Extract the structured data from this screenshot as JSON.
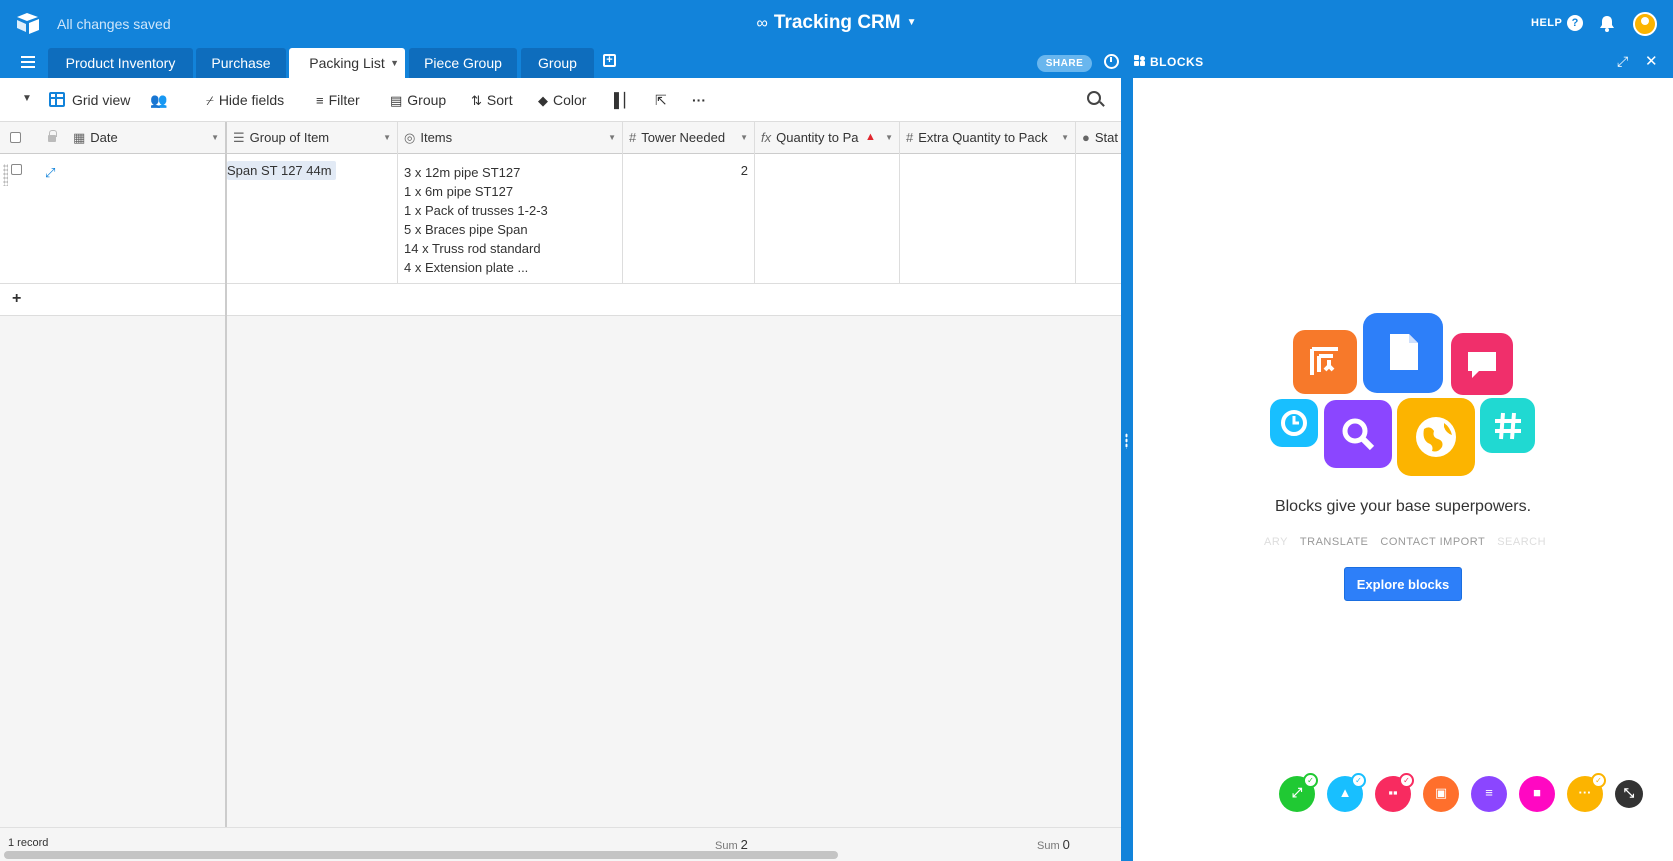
{
  "app": {
    "status_text": "All changes saved",
    "base_title": "Tracking CRM",
    "help_label": "HELP",
    "help_icon_text": "?"
  },
  "tabs": [
    {
      "label": "Product Inventory"
    },
    {
      "label": "Purchase"
    },
    {
      "label": "Packing List",
      "active": true
    },
    {
      "label": "Piece Group"
    },
    {
      "label": "Group"
    }
  ],
  "tabbar": {
    "share_label": "SHARE",
    "blocks_label": "BLOCKS"
  },
  "toolbar": {
    "view_name": "Grid view",
    "hide_fields": "Hide fields",
    "filter": "Filter",
    "group": "Group",
    "sort": "Sort",
    "color": "Color"
  },
  "columns": [
    {
      "label": "Date",
      "icon": "calendar-icon"
    },
    {
      "label": "Group of Item",
      "icon": "link-icon"
    },
    {
      "label": "Items",
      "icon": "lookup-icon"
    },
    {
      "label": "Tower Needed",
      "icon": "number-icon"
    },
    {
      "label": "Quantity to Pa",
      "icon": "formula-icon"
    },
    {
      "label": "Extra Quantity to Pack",
      "icon": "number-icon"
    },
    {
      "label": "Stat",
      "icon": "status-icon"
    }
  ],
  "rows": [
    {
      "date": "",
      "group_of_item": "Span ST 127 44m",
      "items": [
        "3 x 12m pipe ST127",
        "1 x 6m pipe ST127",
        "1 x Pack of trusses 1-2-3",
        "5 x Braces pipe Span",
        "14 x Truss rod standard",
        "4 x Extension plate ..."
      ],
      "tower_needed": "2"
    }
  ],
  "footer": {
    "record_count": "1 record",
    "sum_label": "Sum",
    "sum_tower": "2",
    "sum_extra": "0"
  },
  "blocks_panel": {
    "tagline": "Blocks give your base superpowers.",
    "ticker": [
      "ARY",
      "TRANSLATE",
      "CONTACT IMPORT",
      "SEARCH"
    ],
    "explore_label": "Explore blocks",
    "icons": [
      {
        "name": "page-designer-icon",
        "color": "#f7792a"
      },
      {
        "name": "document-icon",
        "color": "#2d7ff9"
      },
      {
        "name": "chat-icon",
        "color": "#f02f6b"
      },
      {
        "name": "clock-icon",
        "color": "#18bfff"
      },
      {
        "name": "search-icon",
        "color": "#8b46ff"
      },
      {
        "name": "globe-icon",
        "color": "#fcb400"
      },
      {
        "name": "hashtag-icon",
        "color": "#20d9d2"
      }
    ],
    "dock": [
      {
        "name": "dock-green",
        "color": "#20c933"
      },
      {
        "name": "dock-cyan",
        "color": "#18bfff"
      },
      {
        "name": "dock-pink",
        "color": "#f82b60"
      },
      {
        "name": "dock-orange",
        "color": "#ff6f2c"
      },
      {
        "name": "dock-purple",
        "color": "#8b46ff"
      },
      {
        "name": "dock-magenta",
        "color": "#ff08c2"
      },
      {
        "name": "dock-yellow",
        "color": "#fcb400"
      },
      {
        "name": "dock-dark",
        "color": "#333333"
      }
    ]
  },
  "colors": {
    "brand_blue": "#1283da",
    "button_blue": "#2d7ff9"
  }
}
